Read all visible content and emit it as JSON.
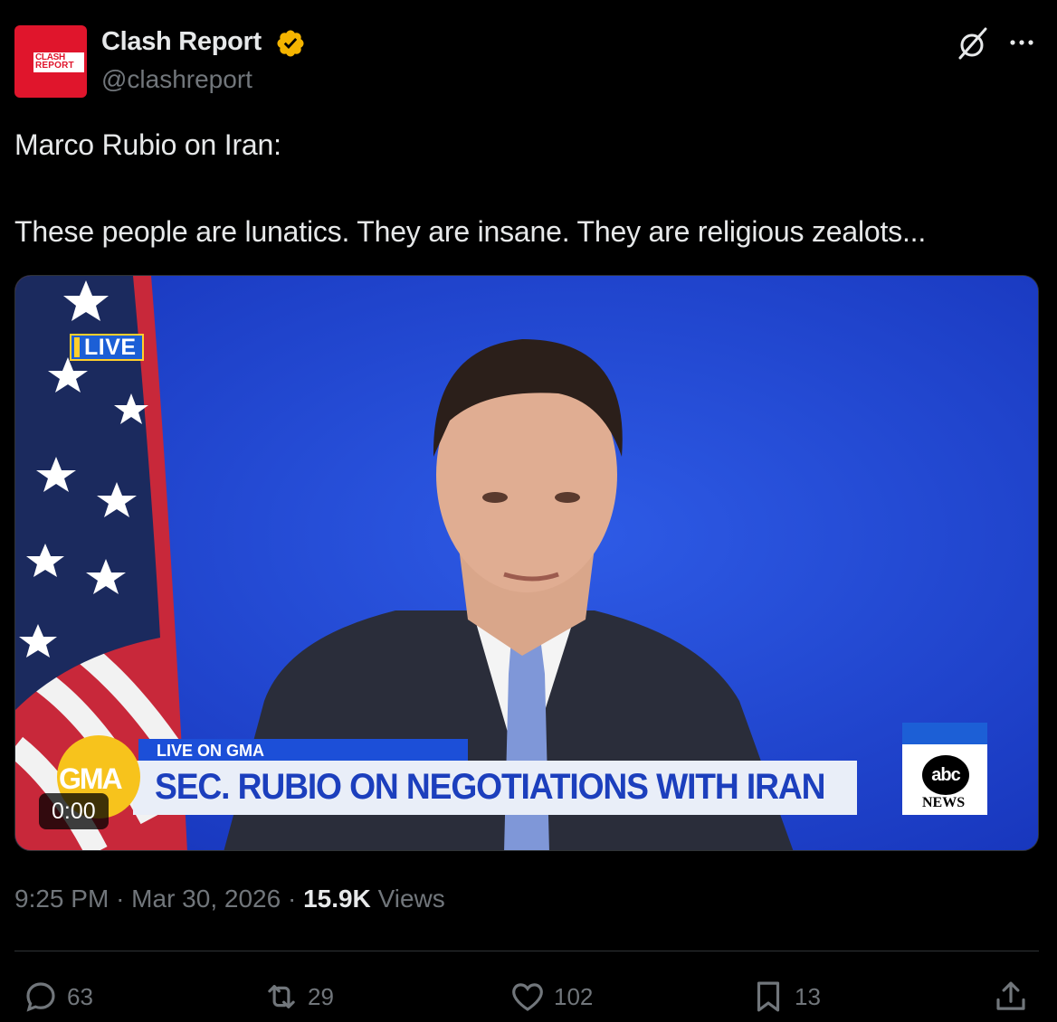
{
  "author": {
    "name": "Clash Report",
    "handle": "@clashreport",
    "avatar_text_line1": "CLASH",
    "avatar_text_line2": "REPORT",
    "verified_color": "#f4b400"
  },
  "post": {
    "line1": "Marco Rubio on Iran:",
    "line2": "These people are lunatics. They are insane. They are religious zealots..."
  },
  "video": {
    "live_badge": "LIVE",
    "lower_third_tag": "LIVE ON GMA",
    "headline": "SEC. RUBIO ON NEGOTIATIONS WITH IRAN",
    "show_logo": "GMA",
    "network_logo": "abc",
    "network_sub": "NEWS",
    "timer": "0:00"
  },
  "meta": {
    "time": "9:25 PM",
    "separator": "·",
    "date": "Mar 30, 2026",
    "views_count": "15.9K",
    "views_label": "Views"
  },
  "actions": {
    "replies": "63",
    "reposts": "29",
    "likes": "102",
    "bookmarks": "13"
  },
  "icons": [
    "grok-icon",
    "more-icon",
    "reply-icon",
    "repost-icon",
    "like-icon",
    "bookmark-icon",
    "share-icon",
    "verified-icon"
  ]
}
